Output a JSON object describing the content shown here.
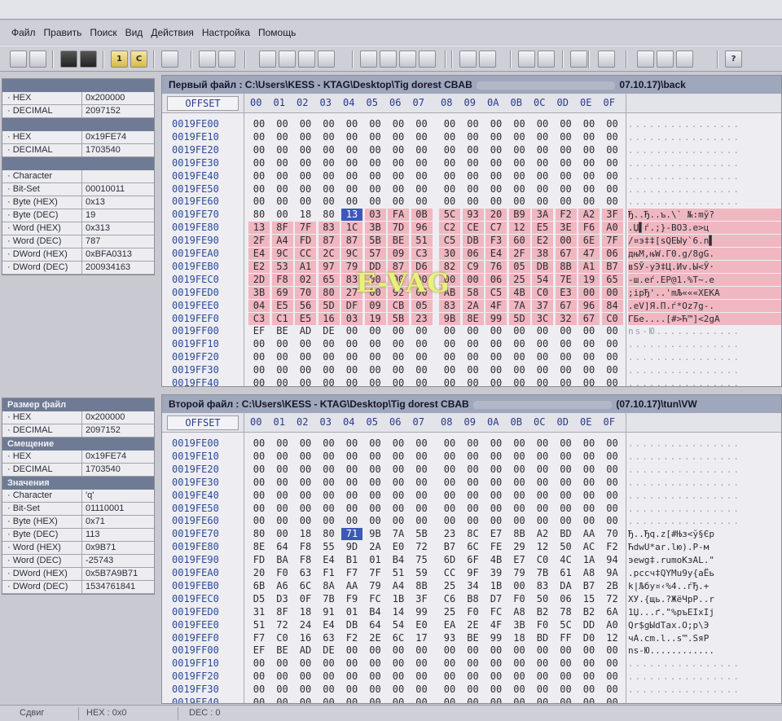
{
  "menu": [
    "Файл",
    "Править",
    "Поиск",
    "Вид",
    "Действия",
    "Настройка",
    "Помощь"
  ],
  "toolbar": {
    "icons": [
      "open-file-1-icon",
      "open-file-2-icon",
      "black-square-icon",
      "stack-icon",
      "one-icon",
      "c-icon",
      "swap-icon",
      "binoculars-icon",
      "find-next-icon",
      "first-diff-icon",
      "prev-diff-icon",
      "next-diff-icon",
      "last-diff-icon",
      "jump-first-icon",
      "jump-prev-icon",
      "jump-next-icon",
      "jump-last-icon",
      "sync-icon",
      "unsync-icon",
      "align-left-icon",
      "align-right-icon",
      "cursor-icon",
      "list-icon",
      "page-icon",
      "copy-page-icon",
      "paste-page-icon",
      "help-icon"
    ],
    "labels": [
      "",
      "",
      "",
      "",
      "1",
      "C",
      "",
      "",
      "",
      "",
      "",
      "",
      "",
      "",
      "",
      "",
      "",
      "",
      "",
      "",
      "",
      "",
      "",
      "",
      "",
      "",
      "?"
    ]
  },
  "panel1": {
    "rows": [
      {
        "k": "HEX",
        "v": "0x200000"
      },
      {
        "k": "DECIMAL",
        "v": "2097152"
      },
      {
        "k": "HEX",
        "v": "0x19FE74"
      },
      {
        "k": "DECIMAL",
        "v": "1703540"
      },
      {
        "k": "Character",
        "v": ""
      },
      {
        "k": "Bit-Set",
        "v": "00010011"
      },
      {
        "k": "Byte (HEX)",
        "v": "0x13"
      },
      {
        "k": "Byte (DEC)",
        "v": "19"
      },
      {
        "k": "Word (HEX)",
        "v": "0x313"
      },
      {
        "k": "Word (DEC)",
        "v": "787"
      },
      {
        "k": "DWord (HEX)",
        "v": "0xBFA0313"
      },
      {
        "k": "DWord (DEC)",
        "v": "200934163"
      }
    ]
  },
  "panel2": {
    "sections": [
      "Размер файл",
      "Смещение",
      "Значения"
    ],
    "rows": [
      {
        "k": "HEX",
        "v": "0x200000"
      },
      {
        "k": "DECIMAL",
        "v": "2097152"
      },
      {
        "k": "HEX",
        "v": "0x19FE74"
      },
      {
        "k": "DECIMAL",
        "v": "1703540"
      },
      {
        "k": "Character",
        "v": "'q'"
      },
      {
        "k": "Bit-Set",
        "v": "01110001"
      },
      {
        "k": "Byte (HEX)",
        "v": "0x71"
      },
      {
        "k": "Byte (DEC)",
        "v": "113"
      },
      {
        "k": "Word (HEX)",
        "v": "0x9B71"
      },
      {
        "k": "Word (DEC)",
        "v": "-25743"
      },
      {
        "k": "DWord (HEX)",
        "v": "0x5B7A9B71"
      },
      {
        "k": "DWord (DEC)",
        "v": "1534761841"
      }
    ]
  },
  "file1": {
    "title_prefix": "Первый файл : C:\\Users\\KESS - KTAG\\Desktop\\Tig dorest CBAB",
    "title_suffix": "07.10.17)\\back"
  },
  "file2": {
    "title_prefix": "Второй файл : C:\\Users\\KESS - KTAG\\Desktop\\Tig dorest CBAB",
    "title_suffix": "(07.10.17)\\tun\\VW"
  },
  "offset_label": "OFFSET",
  "columns": [
    "00",
    "01",
    "02",
    "03",
    "04",
    "05",
    "06",
    "07",
    "08",
    "09",
    "0A",
    "0B",
    "0C",
    "0D",
    "0E",
    "0F"
  ],
  "offsets": [
    "0019FE00",
    "0019FE10",
    "0019FE20",
    "0019FE30",
    "0019FE40",
    "0019FE50",
    "0019FE60",
    "0019FE70",
    "0019FE80",
    "0019FE90",
    "0019FEA0",
    "0019FEB0",
    "0019FEC0",
    "0019FED0",
    "0019FEE0",
    "0019FEF0",
    "0019FF00",
    "0019FF10",
    "0019FF20",
    "0019FF30",
    "0019FF40"
  ],
  "rows1": [
    "00 00 00 00 00 00 00 00 00 00 00 00 00 00 00 00",
    "00 00 00 00 00 00 00 00 00 00 00 00 00 00 00 00",
    "00 00 00 00 00 00 00 00 00 00 00 00 00 00 00 00",
    "00 00 00 00 00 00 00 00 00 00 00 00 00 00 00 00",
    "00 00 00 00 00 00 00 00 00 00 00 00 00 00 00 00",
    "00 00 00 00 00 00 00 00 00 00 00 00 00 00 00 00",
    "00 00 00 00 00 00 00 00 00 00 00 00 00 00 00 00",
    "80 00 18 80 13 03 FA 0B 5C 93 20 B9 3A F2 A2 3F",
    "13 8F 7F 83 1C 3B 7D 96 C2 CE C7 12 E5 3E F6 A0",
    "2F A4 FD 87 87 5B BE 51 C5 DB F3 60 E2 00 6E 7F",
    "E4 9C CC 2C 9C 57 09 C3 30 06 E4 2F 38 67 47 06",
    "E2 53 A1 97 79 DD 87 D6 82 C9 76 05 DB 8B A1 B7",
    "2D F8 02 65 83 00 00 00 00 00 06 25 54 7E 19 65",
    "3B 69 70 80 27 00 92 00 AB 58 C5 4B C0 E3 00 00",
    "04 E5 56 5D DF 09 CB 05 83 2A 4F 7A 37 67 96 84",
    "C3 C1 E5 16 03 19 5B 23 9B 8E 99 5D 3C 32 67 C0",
    "EF BE AD DE 00 00 00 00 00 00 00 00 00 00 00 00",
    "00 00 00 00 00 00 00 00 00 00 00 00 00 00 00 00",
    "00 00 00 00 00 00 00 00 00 00 00 00 00 00 00 00",
    "00 00 00 00 00 00 00 00 00 00 00 00 00 00 00 00",
    "00 00 00 00 00 00 00 00 00 00 00 00 00 00 00 00"
  ],
  "rows2": [
    "00 00 00 00 00 00 00 00 00 00 00 00 00 00 00 00",
    "00 00 00 00 00 00 00 00 00 00 00 00 00 00 00 00",
    "00 00 00 00 00 00 00 00 00 00 00 00 00 00 00 00",
    "00 00 00 00 00 00 00 00 00 00 00 00 00 00 00 00",
    "00 00 00 00 00 00 00 00 00 00 00 00 00 00 00 00",
    "00 00 00 00 00 00 00 00 00 00 00 00 00 00 00 00",
    "00 00 00 00 00 00 00 00 00 00 00 00 00 00 00 00",
    "80 00 18 80 71 9B 7A 5B 23 8C E7 8B A2 BD AA 70",
    "8E 64 F8 55 9D 2A E0 72 B7 6C FE 29 12 50 AC F2",
    "FD BA F8 E4 B1 01 B4 75 6D 6F 4B E7 C0 4C 1A 94",
    "20 F0 63 F1 F7 7F 51 59 CC 9F 39 79 7B 61 A8 9A",
    "6B A6 6C 8A AA 79 A4 8B 25 34 1B 00 83 DA B7 2B",
    "D5 D3 0F 7B F9 FC 1B 3F C6 B8 D7 F0 50 06 15 72",
    "31 8F 18 91 01 B4 14 99 25 F0 FC A8 B2 78 B2 6A",
    "51 72 24 E4 DB 64 54 E0 EA 2E 4F 3B F0 5C DD A0",
    "F7 C0 16 63 F2 2E 6C 17 93 BE 99 18 BD FF D0 12",
    "EF BE AD DE 00 00 00 00 00 00 00 00 00 00 00 00",
    "00 00 00 00 00 00 00 00 00 00 00 00 00 00 00 00",
    "00 00 00 00 00 00 00 00 00 00 00 00 00 00 00 00",
    "00 00 00 00 00 00 00 00 00 00 00 00 00 00 00 00",
    "00 00 00 00 00 00 00 00 00 00 00 00 00 00 00 00"
  ],
  "ascii1": [
    "................",
    "................",
    "................",
    "................",
    "................",
    "................",
    "................",
    "Ђ..Ђ..ъ.\\` №:mў?",
    ".Џ▌ѓ.;}-ВОЗ.е>ц",
    "/¤э‡‡[sQЕЫу`6.n▌",
    "дњМ,њW.Г0.g/8gG.",
    "вSЎ-уЭ‡Ц.Иv.Ы<Ў·",
    "-ш.eѓ.ЕР@1.%T~.e",
    ";ipЂ'..'mЉ«««ХЕКА",
    ".еV]Я.П.ѓ*Оz7g-.",
    "ГБе....[#>Ћ™]<2gА",
    "ns-Ю............",
    "................",
    "................",
    "................",
    "................"
  ],
  "ascii2": [
    "................",
    "................",
    "................",
    "................",
    "................",
    "................",
    "................",
    "Ђ..Ђq.z[#Њз<ў§Єр",
    "ЋdwU*ar.lю).P-м",
    "эеwg‡.rumoKзAL.\"",
    ".pccч‡QYMu9y{aЁь",
    "k|Љбу¤‹%4..ѓЂ.+",
    "ХУ.{щь.?ЖёЧрР..r",
    "1Џ...ґ.\"%ръЕIxIj",
    "Qr$gЫdТax.О;p\\Э",
    "чА.cm.l..s™.ЅяР",
    "ns-Ю............",
    "................",
    "................",
    "................",
    "................"
  ],
  "watermark": "E-VAG",
  "status": {
    "shift": "Сдвиг",
    "hex": "HEX : 0x0",
    "dec": "DEC : 0"
  }
}
